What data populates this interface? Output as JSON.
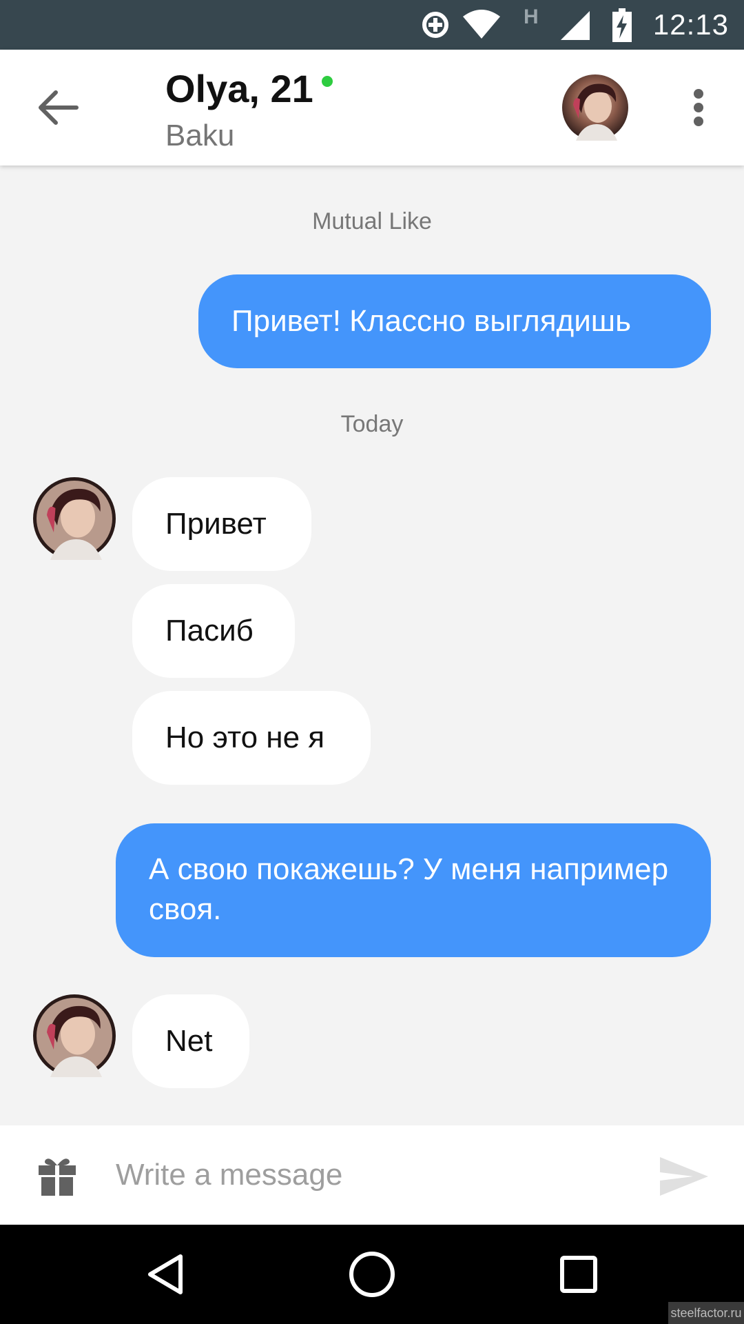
{
  "status_bar": {
    "time": "12:13",
    "network_type": "H",
    "icons": [
      "data-saver-icon",
      "wifi-icon",
      "network-h-icon",
      "signal-icon",
      "battery-charging-icon"
    ]
  },
  "header": {
    "name_age": "Olya, 21",
    "city": "Baku",
    "online": true,
    "online_color": "#2ecc40",
    "icons": [
      "back-arrow-icon",
      "avatar",
      "more-vert-icon"
    ]
  },
  "chat": {
    "mutual_like_label": "Mutual Like",
    "date_label": "Today",
    "messages": [
      {
        "from": "me",
        "text": "Привет! Классно выглядишь"
      },
      {
        "from": "them",
        "text": "Привет"
      },
      {
        "from": "them",
        "text": "Пасиб"
      },
      {
        "from": "them",
        "text": "Но это не я"
      },
      {
        "from": "me",
        "text": "А свою покажешь? У меня например своя."
      },
      {
        "from": "them",
        "text": "Net"
      }
    ],
    "outgoing_color": "#4495fb",
    "incoming_color": "#ffffff"
  },
  "composer": {
    "placeholder": "Write a message",
    "value": "",
    "icons": [
      "gift-icon",
      "send-icon"
    ]
  },
  "nav_bar": {
    "icons": [
      "back-triangle-icon",
      "home-circle-icon",
      "recents-square-icon"
    ]
  },
  "watermark": "steelfactor.ru"
}
